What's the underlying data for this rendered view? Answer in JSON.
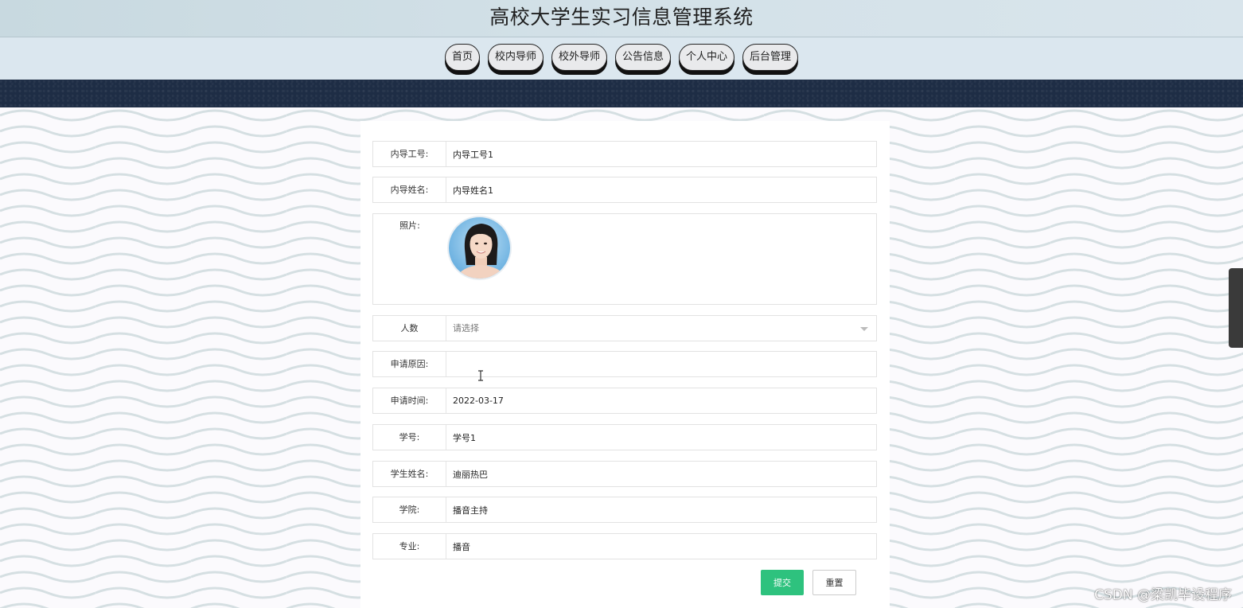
{
  "app": {
    "title": "高校大学生实习信息管理系统"
  },
  "nav": {
    "items": [
      {
        "label": "首页"
      },
      {
        "label": "校内导师"
      },
      {
        "label": "校外导师"
      },
      {
        "label": "公告信息"
      },
      {
        "label": "个人中心"
      },
      {
        "label": "后台管理"
      }
    ]
  },
  "form": {
    "teacher_id": {
      "label": "内导工号:",
      "value": "内导工号1"
    },
    "teacher_name": {
      "label": "内导姓名:",
      "value": "内导姓名1"
    },
    "photo": {
      "label": "照片:"
    },
    "headcount": {
      "label": "人数",
      "placeholder": "请选择"
    },
    "reason": {
      "label": "申请原因:",
      "value": ""
    },
    "apply_time": {
      "label": "申请时间:",
      "value": "2022-03-17"
    },
    "student_id": {
      "label": "学号:",
      "value": "学号1"
    },
    "student_name": {
      "label": "学生姓名:",
      "value": "迪丽热巴"
    },
    "college": {
      "label": "学院:",
      "value": "播音主持"
    },
    "major": {
      "label": "专业:",
      "value": "播音"
    },
    "submit_label": "提交",
    "reset_label": "重置"
  },
  "watermark": "CSDN @梁凯毕设程序",
  "colors": {
    "accent": "#2ec27e",
    "header": "#d3e1e8",
    "nav": "#dbe7ef",
    "band": "#1e2d45"
  }
}
